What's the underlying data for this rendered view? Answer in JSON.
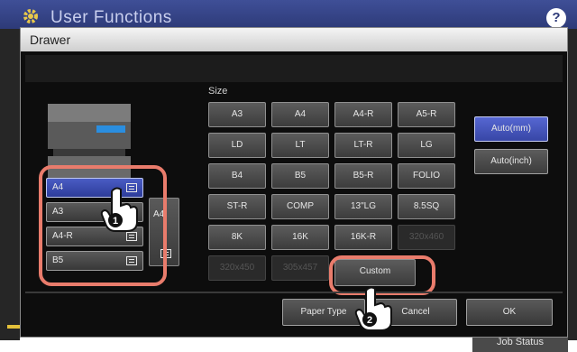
{
  "app": {
    "title": "User Functions",
    "help_label": "?",
    "job_status_label": "Job Status"
  },
  "dialog": {
    "title": "Drawer"
  },
  "drawers": [
    {
      "label": "A4",
      "selected": true
    },
    {
      "label": "A3",
      "selected": false
    },
    {
      "label": "A4-R",
      "selected": false
    },
    {
      "label": "B5",
      "selected": false
    }
  ],
  "bypass": {
    "label": "A4"
  },
  "size_section": {
    "label": "Size"
  },
  "sizes": [
    {
      "label": "A3",
      "enabled": true
    },
    {
      "label": "A4",
      "enabled": true
    },
    {
      "label": "A4-R",
      "enabled": true
    },
    {
      "label": "A5-R",
      "enabled": true
    },
    {
      "label": "LD",
      "enabled": true
    },
    {
      "label": "LT",
      "enabled": true
    },
    {
      "label": "LT-R",
      "enabled": true
    },
    {
      "label": "LG",
      "enabled": true
    },
    {
      "label": "B4",
      "enabled": true
    },
    {
      "label": "B5",
      "enabled": true
    },
    {
      "label": "B5-R",
      "enabled": true
    },
    {
      "label": "FOLIO",
      "enabled": true
    },
    {
      "label": "ST-R",
      "enabled": true
    },
    {
      "label": "COMP",
      "enabled": true
    },
    {
      "label": "13\"LG",
      "enabled": true
    },
    {
      "label": "8.5SQ",
      "enabled": true
    },
    {
      "label": "8K",
      "enabled": true
    },
    {
      "label": "16K",
      "enabled": true
    },
    {
      "label": "16K-R",
      "enabled": true
    },
    {
      "label": "320x460",
      "enabled": false
    },
    {
      "label": "320x450",
      "enabled": false
    },
    {
      "label": "305x457",
      "enabled": false
    },
    {
      "label": "Custom",
      "enabled": true
    }
  ],
  "modes": [
    {
      "label": "Auto(mm)",
      "selected": true
    },
    {
      "label": "Auto(inch)",
      "selected": false
    }
  ],
  "footer": {
    "paper_type_label": "Paper Type",
    "cancel_label": "Cancel",
    "ok_label": "OK"
  },
  "callouts": {
    "first": "1",
    "second": "2"
  },
  "colors": {
    "selected": "#3d4fb8",
    "callout": "#e97c6c",
    "panel": "#0d0d0d"
  }
}
